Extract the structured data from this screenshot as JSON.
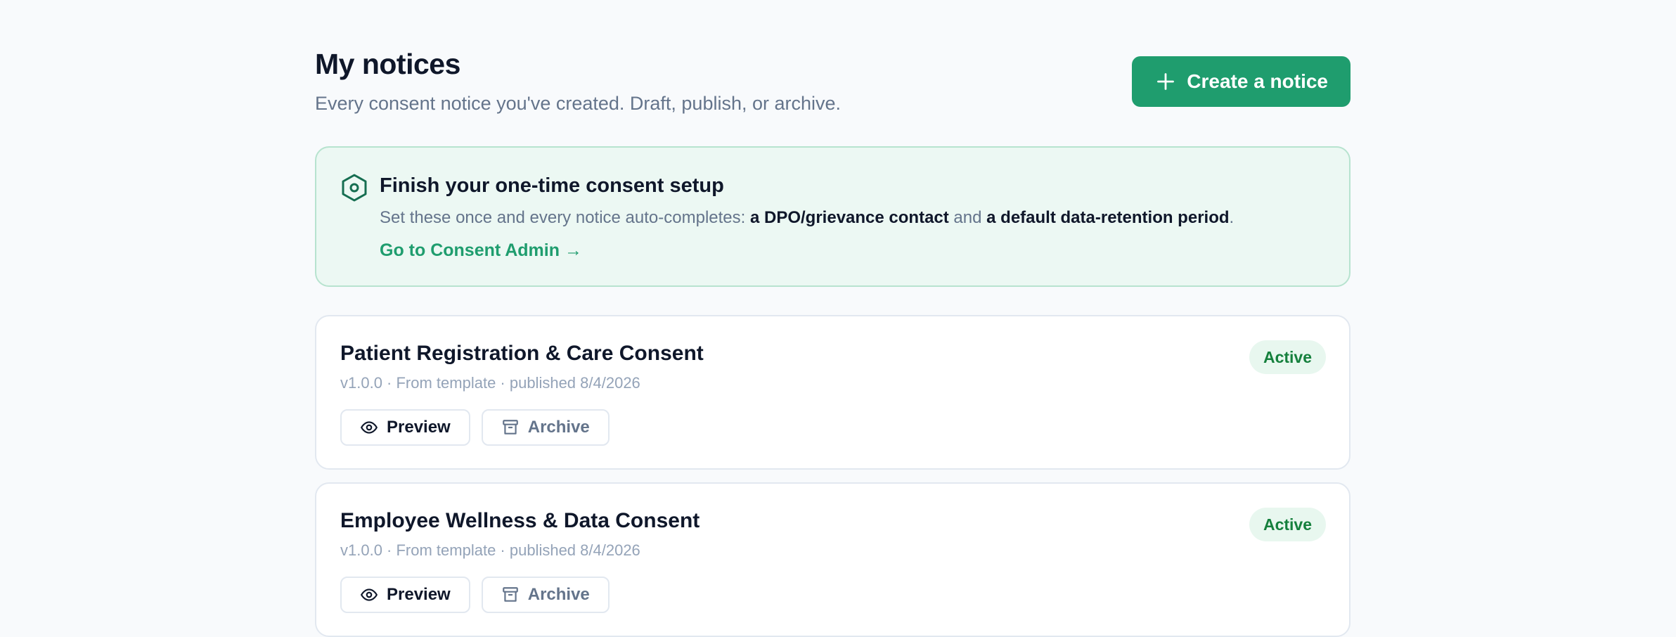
{
  "header": {
    "title": "My notices",
    "subtitle": "Every consent notice you've created. Draft, publish, or archive.",
    "create_label": "Create a notice"
  },
  "setup": {
    "title": "Finish your one-time consent setup",
    "desc_prefix": "Set these once and every notice auto-completes: ",
    "desc_strong_1": "a DPO/grievance contact",
    "desc_middle": " and ",
    "desc_strong_2": "a default data-retention period",
    "desc_suffix": ".",
    "link_label": "Go to Consent Admin →"
  },
  "notices": [
    {
      "title": "Patient Registration & Care Consent",
      "meta": "v1.0.0 · From template · published 8/4/2026",
      "status": "Active",
      "preview_label": "Preview",
      "archive_label": "Archive"
    },
    {
      "title": "Employee Wellness & Data Consent",
      "meta": "v1.0.0 · From template · published 8/4/2026",
      "status": "Active",
      "preview_label": "Preview",
      "archive_label": "Archive"
    }
  ],
  "colors": {
    "accent": "#1f9d6e",
    "setup_bg": "#ecf8f3",
    "badge_bg": "#e8f7ef",
    "badge_text": "#15803d"
  },
  "icons": {
    "create": "plus-icon",
    "setup": "hexagon-settings-icon",
    "preview": "eye-icon",
    "archive": "archive-box-icon"
  }
}
